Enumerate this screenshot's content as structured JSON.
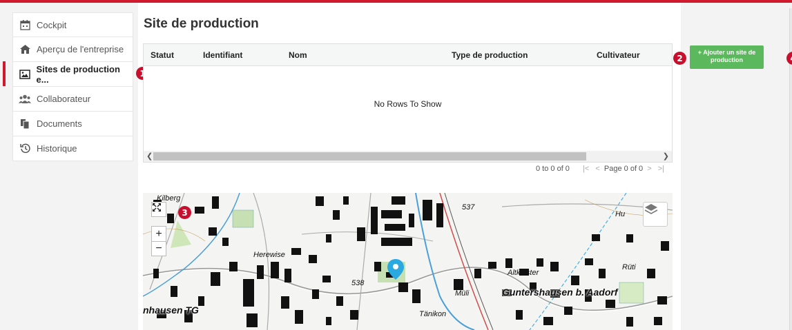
{
  "sidebar": {
    "items": [
      {
        "label": "Cockpit",
        "icon": "calendar-icon"
      },
      {
        "label": "Aperçu de l'entreprise",
        "icon": "farm-icon"
      },
      {
        "label": "Sites de production e...",
        "icon": "image-icon"
      },
      {
        "label": "Collaborateur",
        "icon": "users-icon"
      },
      {
        "label": "Documents",
        "icon": "documents-icon"
      },
      {
        "label": "Historique",
        "icon": "history-icon"
      }
    ]
  },
  "badges": [
    "1",
    "2",
    "3",
    "4"
  ],
  "main": {
    "title": "Site de production",
    "grid": {
      "columns": [
        "Statut",
        "Identifiant",
        "Nom",
        "Type de production",
        "Cultivateur"
      ],
      "empty_text": "No Rows To Show"
    },
    "pager": {
      "summary": "0 to 0 of 0",
      "first": "|<",
      "prev": "<",
      "page_text": "Page 0 of 0",
      "next": ">",
      "last": ">|"
    },
    "add_button": "+ Ajouter un site de production"
  },
  "map": {
    "zoom_in": "+",
    "zoom_out": "−",
    "labels": {
      "kilberg": "Kilberg",
      "herewise": "Herewise",
      "road538": "538",
      "road537": "537",
      "altkloster": "Altkloster",
      "guntershausen": "Guntershausen b. Aadorf",
      "ettenhausen": "nhausen TG",
      "tanikon": "Tänikon",
      "muli": "Müli",
      "ruti": "Rüti",
      "hu": "Hu"
    }
  },
  "colors": {
    "accent": "#d1192e",
    "button_green": "#5cb85c",
    "marker": "#29a9e0"
  }
}
